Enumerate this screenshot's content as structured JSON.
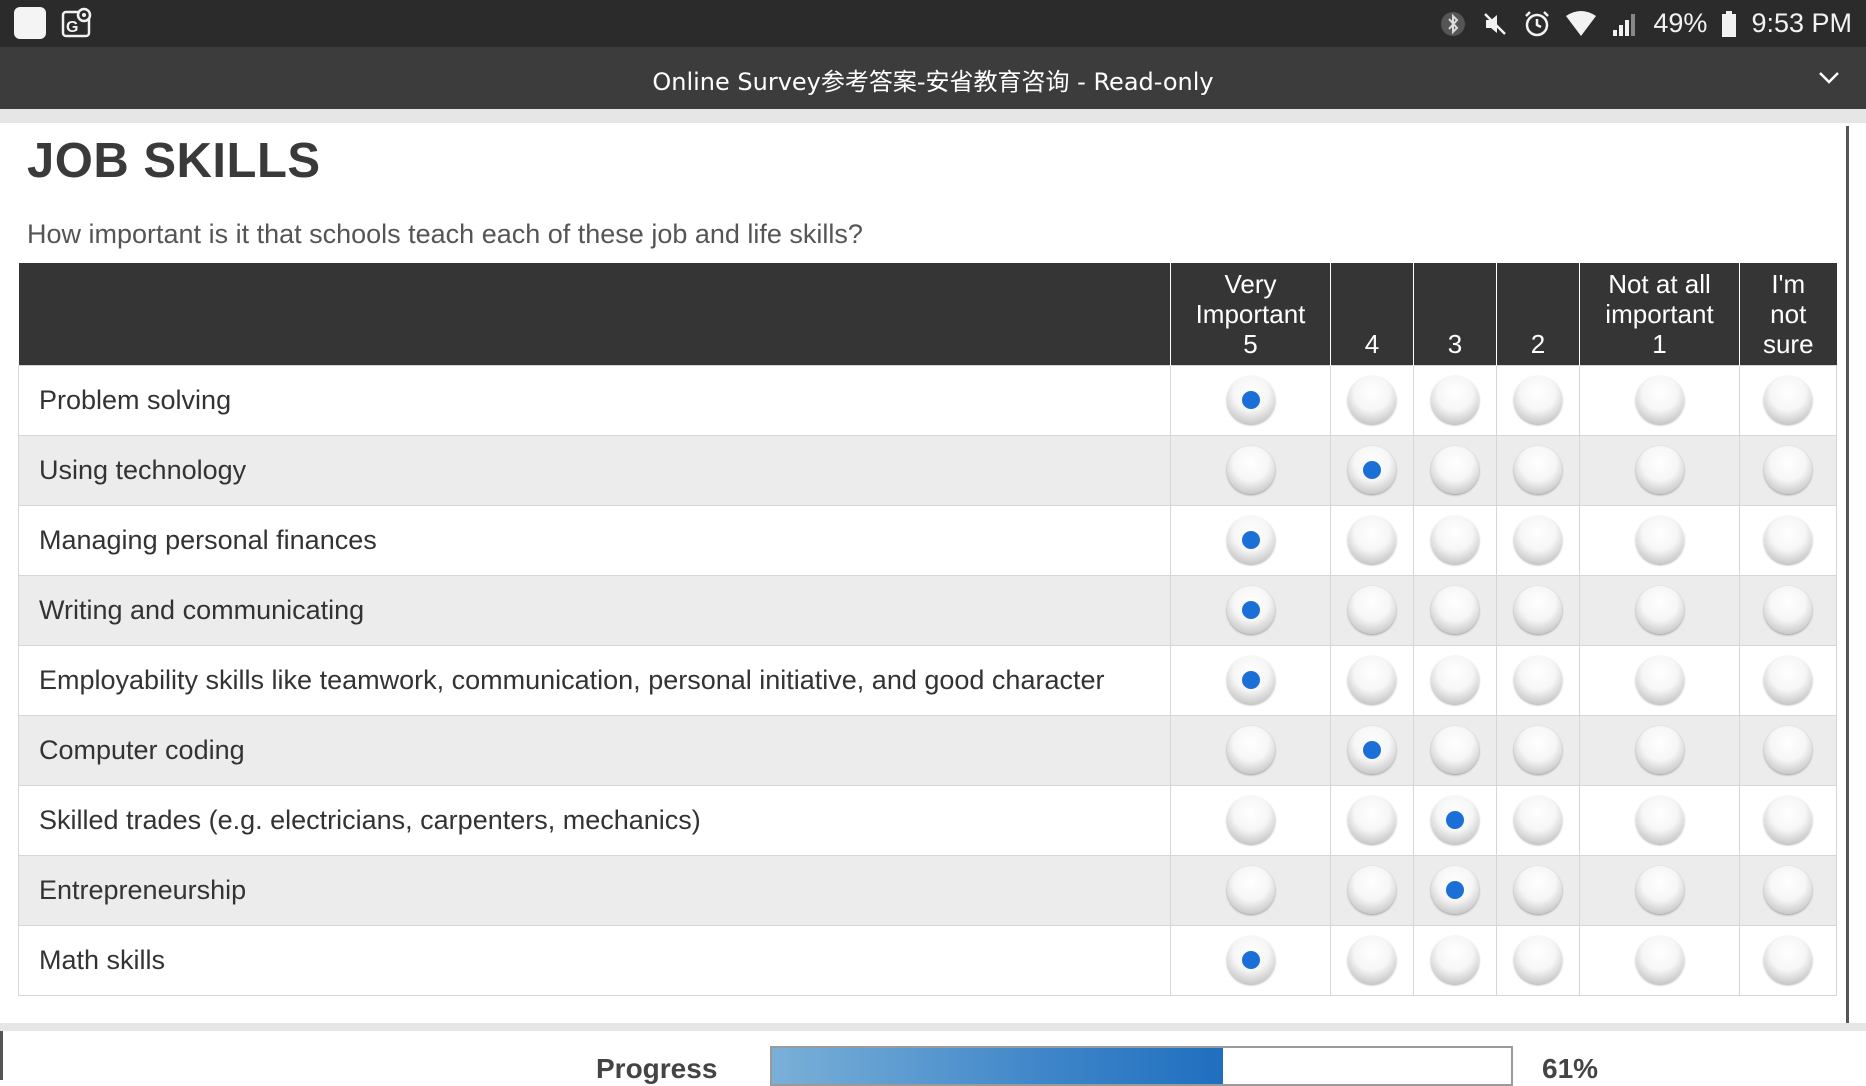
{
  "status_bar": {
    "battery": "49%",
    "time": "9:53 PM",
    "icons": [
      "app-icon",
      "maps-icon",
      "bluetooth-icon",
      "mute-icon",
      "alarm-icon",
      "wifi-icon",
      "signal-icon",
      "battery-icon"
    ]
  },
  "title_bar": {
    "title": "Online Survey参考答案-安省教育咨询 - Read-only"
  },
  "section": {
    "title": "JOB SKILLS",
    "question": "How important is it that schools teach each of these job and life skills?"
  },
  "table": {
    "columns": [
      {
        "lines": [
          "Very",
          "Important",
          "5"
        ]
      },
      {
        "lines": [
          "4"
        ]
      },
      {
        "lines": [
          "3"
        ]
      },
      {
        "lines": [
          "2"
        ]
      },
      {
        "lines": [
          "Not at all",
          "important",
          "1"
        ]
      },
      {
        "lines": [
          "I'm",
          "not",
          "sure"
        ]
      }
    ],
    "rows": [
      {
        "label": "Problem solving",
        "selected": 0
      },
      {
        "label": "Using technology",
        "selected": 1
      },
      {
        "label": "Managing personal finances",
        "selected": 0
      },
      {
        "label": "Writing and communicating",
        "selected": 0
      },
      {
        "label": "Employability skills like teamwork, communication, personal initiative, and good character",
        "selected": 0
      },
      {
        "label": "Computer coding",
        "selected": 1
      },
      {
        "label": "Skilled trades (e.g. electricians, carpenters, mechanics)",
        "selected": 2
      },
      {
        "label": "Entrepreneurship",
        "selected": 2
      },
      {
        "label": "Math skills",
        "selected": 0
      }
    ]
  },
  "progress": {
    "label": "Progress",
    "value_text": "61%",
    "fraction": 0.61
  },
  "colors": {
    "status_bar_bg": "#2b2b2b",
    "title_bar_bg": "#3c3c3c",
    "header_bg": "#353535",
    "radio_selected": "#1c6fd6",
    "progress_fill": "#3f86c9"
  }
}
